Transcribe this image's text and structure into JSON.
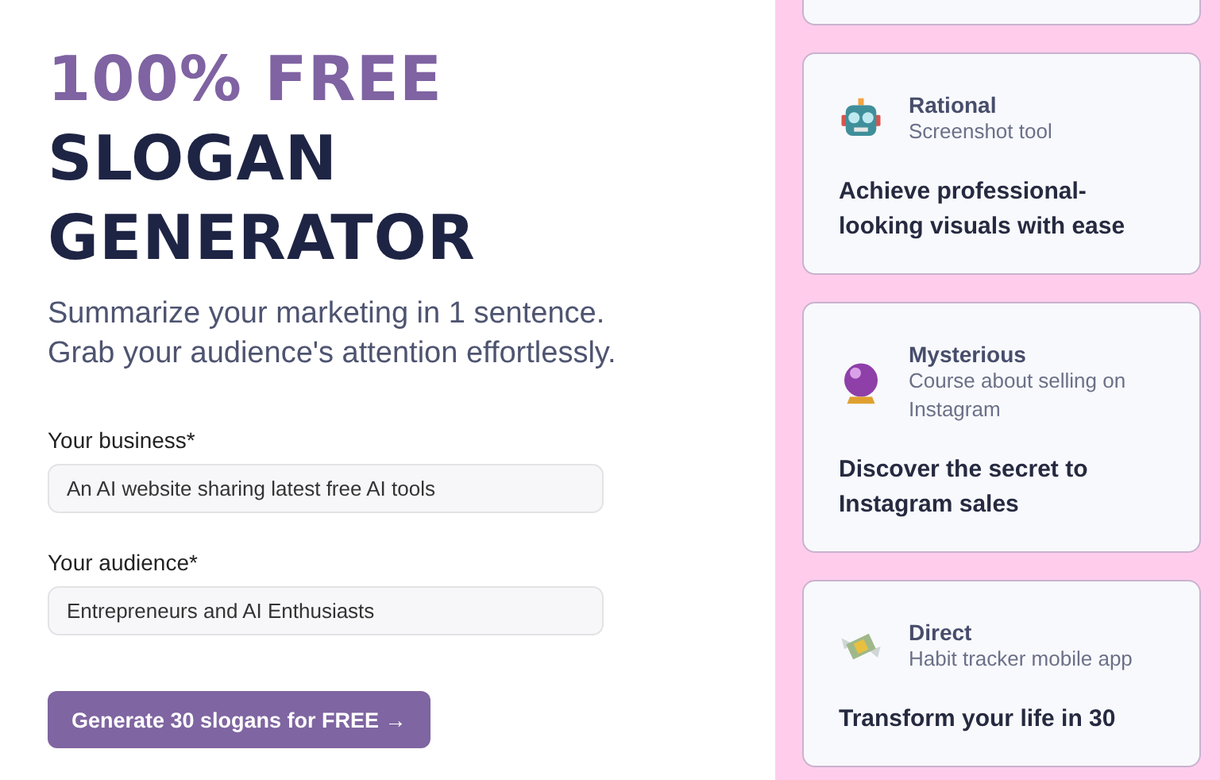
{
  "hero": {
    "title_accent": "100% FREE",
    "title_lines": [
      "SLOGAN",
      "GENERATOR"
    ],
    "subtitle_lines": [
      "Summarize your marketing in 1 sentence.",
      "Grab your audience's attention effortlessly."
    ]
  },
  "form": {
    "fields": [
      {
        "label": "Your business*",
        "value": "An AI website sharing latest free AI tools"
      },
      {
        "label": "Your audience*",
        "value": "Entrepreneurs and AI Enthusiasts"
      }
    ],
    "submit": "Generate 30 slogans for FREE →"
  },
  "examples": [
    {
      "kind": "robot",
      "tone": "Rational",
      "product": "Screenshot tool",
      "slogan": "Achieve professional-looking visuals with ease"
    },
    {
      "kind": "crystal-ball",
      "tone": "Mysterious",
      "product": "Course about selling on Instagram",
      "slogan": "Discover the secret to Instagram sales"
    },
    {
      "kind": "money",
      "tone": "Direct",
      "product": "Habit tracker mobile app",
      "slogan": "Transform your life in 30"
    }
  ]
}
